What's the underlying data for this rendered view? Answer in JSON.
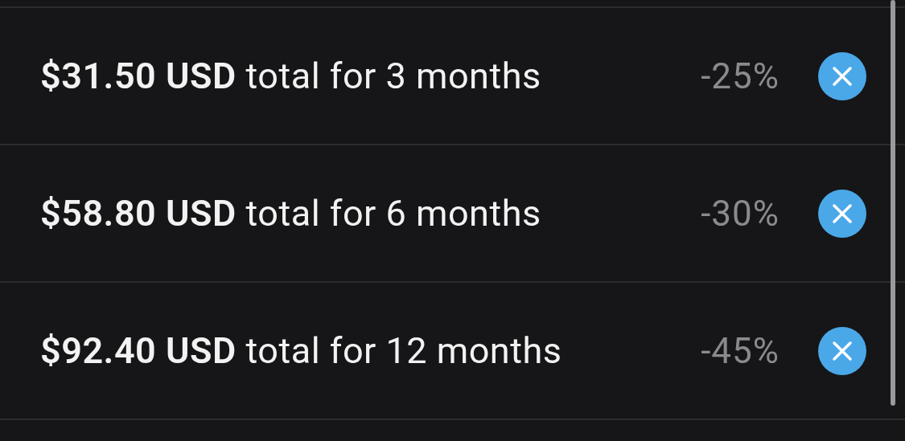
{
  "bundles": [
    {
      "label": "**$31.50 USD** total for 3 months",
      "discount": "-25%"
    },
    {
      "label": "**$58.80 USD** total for 6 months",
      "discount": "-30%"
    },
    {
      "label": "**$92.40 USD** total for 12 months",
      "discount": "-45%"
    }
  ]
}
